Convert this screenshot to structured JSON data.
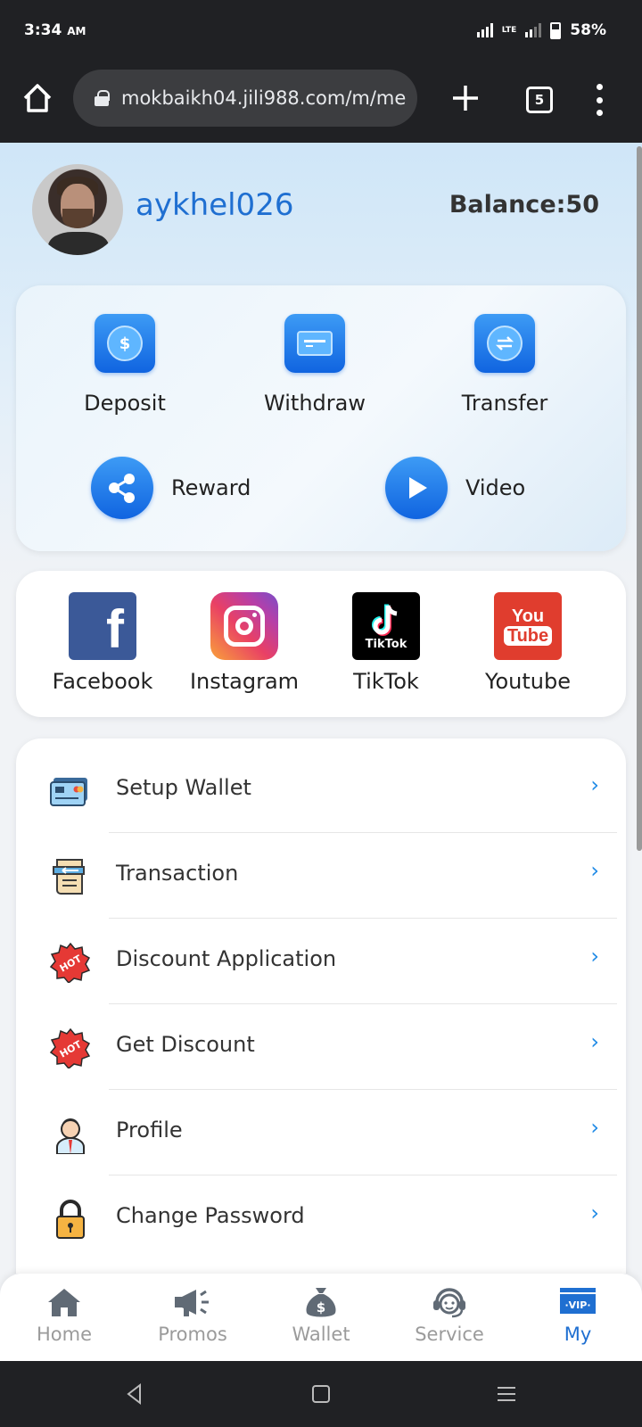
{
  "status_bar": {
    "time": "3:34",
    "ampm": "AM",
    "network": "LTE",
    "battery": "58%"
  },
  "browser": {
    "url": "mokbaikh04.jili988.com/m/me",
    "tab_count": "5"
  },
  "profile": {
    "username": "aykhel026",
    "balance": "Balance:50"
  },
  "actions": [
    {
      "label": "Deposit",
      "icon": "dollar-coin-icon"
    },
    {
      "label": "Withdraw",
      "icon": "card-icon"
    },
    {
      "label": "Transfer",
      "icon": "exchange-icon"
    }
  ],
  "round_actions": [
    {
      "label": "Reward",
      "icon": "share-icon"
    },
    {
      "label": "Video",
      "icon": "play-icon"
    }
  ],
  "social": [
    {
      "label": "Facebook",
      "icon": "facebook-icon"
    },
    {
      "label": "Instagram",
      "icon": "instagram-icon"
    },
    {
      "label": "TikTok",
      "icon": "tiktok-icon",
      "icon_text": "TikTok"
    },
    {
      "label": "Youtube",
      "icon": "youtube-icon",
      "icon_text_top": "You",
      "icon_text_bottom": "Tube"
    }
  ],
  "menu": [
    {
      "label": "Setup Wallet",
      "icon": "wallet-card-icon"
    },
    {
      "label": "Transaction",
      "icon": "receipt-icon"
    },
    {
      "label": "Discount Application",
      "icon": "hot-badge-icon",
      "icon_text": "HOT"
    },
    {
      "label": "Get Discount",
      "icon": "hot-badge-icon",
      "icon_text": "HOT"
    },
    {
      "label": "Profile",
      "icon": "person-icon"
    },
    {
      "label": "Change Password",
      "icon": "padlock-icon"
    }
  ],
  "tabbar": [
    {
      "label": "Home",
      "icon": "home-icon",
      "active": false
    },
    {
      "label": "Promos",
      "icon": "megaphone-icon",
      "active": false
    },
    {
      "label": "Wallet",
      "icon": "money-bag-icon",
      "active": false
    },
    {
      "label": "Service",
      "icon": "headset-icon",
      "active": false
    },
    {
      "label": "My",
      "icon": "vip-icon",
      "icon_text": "·VIP·",
      "active": true
    }
  ],
  "colors": {
    "accent": "#1f6fd1",
    "icon_blue": "#1064e0",
    "chevron": "#1f8ae6",
    "chrome_dark": "#202124"
  }
}
